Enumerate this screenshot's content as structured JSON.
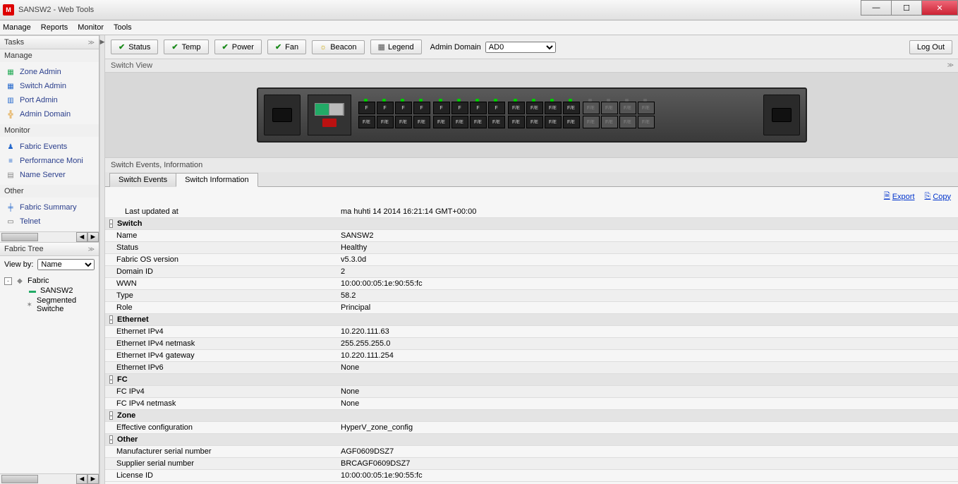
{
  "window": {
    "title": "SANSW2 - Web Tools"
  },
  "menu": [
    "Manage",
    "Reports",
    "Monitor",
    "Tools"
  ],
  "sidebar": {
    "tasksTitle": "Tasks",
    "groups": [
      {
        "title": "Manage",
        "items": [
          {
            "label": "Zone Admin",
            "icon": "▦",
            "color": "#2a5"
          },
          {
            "label": "Switch Admin",
            "icon": "▦",
            "color": "#26c"
          },
          {
            "label": "Port Admin",
            "icon": "▥",
            "color": "#26c"
          },
          {
            "label": "Admin Domain",
            "icon": "╬",
            "color": "#d80"
          }
        ]
      },
      {
        "title": "Monitor",
        "items": [
          {
            "label": "Fabric Events",
            "icon": "♟",
            "color": "#26c"
          },
          {
            "label": "Performance Moni",
            "icon": "≡",
            "color": "#26c"
          },
          {
            "label": "Name Server",
            "icon": "▤",
            "color": "#888"
          }
        ]
      },
      {
        "title": "Other",
        "items": [
          {
            "label": "Fabric Summary",
            "icon": "╪",
            "color": "#26c"
          },
          {
            "label": "Telnet",
            "icon": "▭",
            "color": "#666"
          }
        ]
      }
    ],
    "fabricTreeTitle": "Fabric Tree",
    "viewByLabel": "View by:",
    "viewByValue": "Name",
    "tree": [
      {
        "indent": 0,
        "exp": "⊟",
        "icon": "◆",
        "color": "#888",
        "label": "Fabric"
      },
      {
        "indent": 1,
        "exp": "",
        "icon": "▬",
        "color": "#2a6",
        "label": "SANSW2"
      },
      {
        "indent": 1,
        "exp": "",
        "icon": "✶",
        "color": "#888",
        "label": "Segmented Switche"
      }
    ]
  },
  "toolbar": {
    "status": "Status",
    "temp": "Temp",
    "power": "Power",
    "fan": "Fan",
    "beacon": "Beacon",
    "legend": "Legend",
    "adminDomainLabel": "Admin Domain",
    "adminDomainValue": "AD0",
    "logout": "Log Out"
  },
  "switchViewTitle": "Switch View",
  "ports": {
    "g1": [
      [
        "F",
        "F",
        "F",
        "F"
      ],
      [
        "F/E",
        "F/E",
        "F/E",
        "F/E"
      ]
    ],
    "g2": [
      [
        "F",
        "F",
        "F",
        "F"
      ],
      [
        "F/E",
        "F/E",
        "F/E",
        "F/E"
      ]
    ],
    "g3": [
      [
        "F/E",
        "F/E",
        "F/E",
        "F/E"
      ],
      [
        "F/E",
        "F/E",
        "F/E",
        "F/E"
      ]
    ],
    "g4": [
      [
        "F/E",
        "F/E",
        "F/E",
        "F/E"
      ],
      [
        "F/E",
        "F/E",
        "F/E",
        "F/E"
      ]
    ]
  },
  "eventsTitle": "Switch Events, Information",
  "tabs": {
    "events": "Switch Events",
    "info": "Switch Information"
  },
  "links": {
    "export": "Export",
    "copy": "Copy"
  },
  "info": [
    {
      "type": "plain",
      "key": "Last updated at",
      "val": "ma huhti 14 2014 16:21:14 GMT+00:00"
    },
    {
      "type": "section",
      "key": "Switch"
    },
    {
      "type": "row",
      "key": "Name",
      "val": "SANSW2"
    },
    {
      "type": "row",
      "key": "Status",
      "val": "Healthy"
    },
    {
      "type": "row",
      "key": "Fabric OS version",
      "val": "v5.3.0d"
    },
    {
      "type": "row",
      "key": "Domain ID",
      "val": "2"
    },
    {
      "type": "row",
      "key": "WWN",
      "val": "10:00:00:05:1e:90:55:fc"
    },
    {
      "type": "row",
      "key": "Type",
      "val": "58.2"
    },
    {
      "type": "row",
      "key": "Role",
      "val": "Principal"
    },
    {
      "type": "section",
      "key": "Ethernet"
    },
    {
      "type": "row",
      "key": "Ethernet IPv4",
      "val": "10.220.111.63"
    },
    {
      "type": "row",
      "key": "Ethernet IPv4 netmask",
      "val": "255.255.255.0"
    },
    {
      "type": "row",
      "key": "Ethernet IPv4 gateway",
      "val": "10.220.111.254"
    },
    {
      "type": "row",
      "key": "Ethernet IPv6",
      "val": "None"
    },
    {
      "type": "section",
      "key": "FC"
    },
    {
      "type": "row",
      "key": "FC IPv4",
      "val": "None"
    },
    {
      "type": "row",
      "key": "FC IPv4 netmask",
      "val": "None"
    },
    {
      "type": "section",
      "key": "Zone"
    },
    {
      "type": "row",
      "key": "Effective configuration",
      "val": "HyperV_zone_config"
    },
    {
      "type": "section",
      "key": "Other"
    },
    {
      "type": "row",
      "key": "Manufacturer serial number",
      "val": "AGF0609DSZ7"
    },
    {
      "type": "row",
      "key": "Supplier serial number",
      "val": "BRCAGF0609DSZ7"
    },
    {
      "type": "row",
      "key": "License ID",
      "val": "10:00:00:05:1e:90:55:fc"
    }
  ]
}
